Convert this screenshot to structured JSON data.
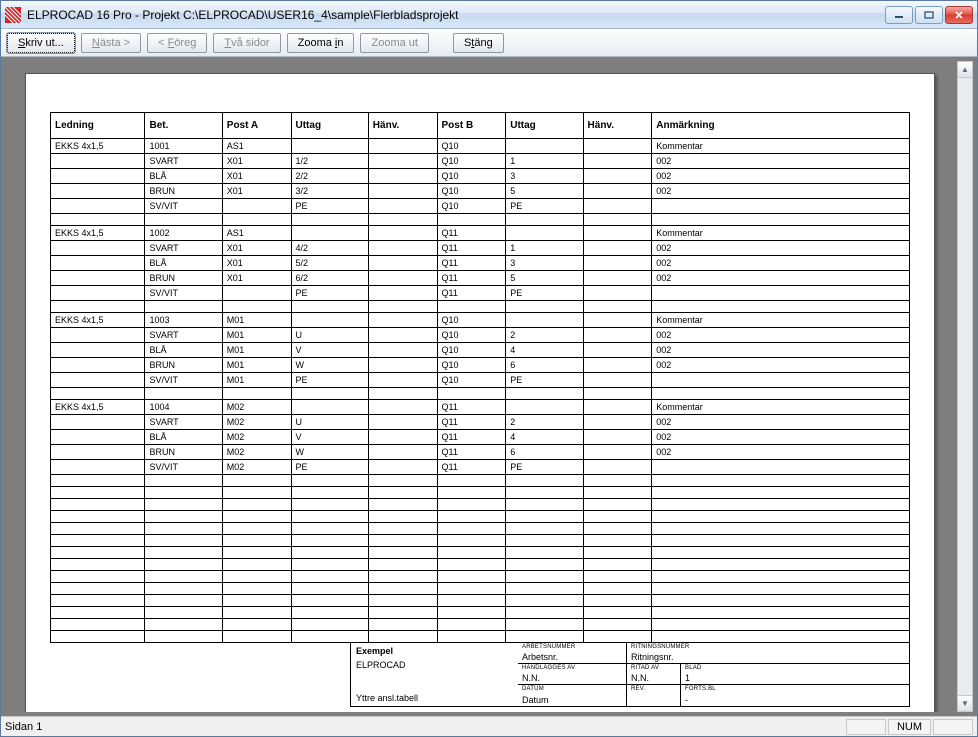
{
  "window": {
    "title": "ELPROCAD 16 Pro - Projekt C:\\ELPROCAD\\USER16_4\\sample\\Flerbladsprojekt"
  },
  "toolbar": {
    "print": "Skriv ut...",
    "next": "Nästa >",
    "prev": "< Föreg",
    "two_pages": "Två sidor",
    "zoom_in": "Zooma in",
    "zoom_out": "Zooma ut",
    "close": "Stäng"
  },
  "table": {
    "headers": {
      "ledning": "Ledning",
      "bet": "Bet.",
      "post_a": "Post A",
      "uttag_a": "Uttag",
      "hanv_a": "Hänv.",
      "post_b": "Post B",
      "uttag_b": "Uttag",
      "hanv_b": "Hänv.",
      "anm": "Anmärkning"
    },
    "groups": [
      {
        "ledning": "EKKS 4x1,5",
        "bet": "1001",
        "post_a": "AS1",
        "post_b": "Q10",
        "anm": "Kommentar",
        "rows": [
          {
            "bet": "SVART",
            "post_a": "X01",
            "uttag_a": "1/2",
            "post_b": "Q10",
            "uttag_b": "1",
            "anm": "002"
          },
          {
            "bet": "BLÅ",
            "post_a": "X01",
            "uttag_a": "2/2",
            "post_b": "Q10",
            "uttag_b": "3",
            "anm": "002"
          },
          {
            "bet": "BRUN",
            "post_a": "X01",
            "uttag_a": "3/2",
            "post_b": "Q10",
            "uttag_b": "5",
            "anm": "002"
          },
          {
            "bet": "SV/VIT",
            "post_a": "",
            "uttag_a": "PE",
            "post_b": "Q10",
            "uttag_b": "PE",
            "anm": ""
          }
        ]
      },
      {
        "ledning": "EKKS 4x1,5",
        "bet": "1002",
        "post_a": "AS1",
        "post_b": "Q11",
        "anm": "Kommentar",
        "rows": [
          {
            "bet": "SVART",
            "post_a": "X01",
            "uttag_a": "4/2",
            "post_b": "Q11",
            "uttag_b": "1",
            "anm": "002"
          },
          {
            "bet": "BLÅ",
            "post_a": "X01",
            "uttag_a": "5/2",
            "post_b": "Q11",
            "uttag_b": "3",
            "anm": "002"
          },
          {
            "bet": "BRUN",
            "post_a": "X01",
            "uttag_a": "6/2",
            "post_b": "Q11",
            "uttag_b": "5",
            "anm": "002"
          },
          {
            "bet": "SV/VIT",
            "post_a": "",
            "uttag_a": "PE",
            "post_b": "Q11",
            "uttag_b": "PE",
            "anm": ""
          }
        ]
      },
      {
        "ledning": "EKKS 4x1,5",
        "bet": "1003",
        "post_a": "M01",
        "post_b": "Q10",
        "anm": "Kommentar",
        "rows": [
          {
            "bet": "SVART",
            "post_a": "M01",
            "uttag_a": "U",
            "post_b": "Q10",
            "uttag_b": "2",
            "anm": "002"
          },
          {
            "bet": "BLÅ",
            "post_a": "M01",
            "uttag_a": "V",
            "post_b": "Q10",
            "uttag_b": "4",
            "anm": "002"
          },
          {
            "bet": "BRUN",
            "post_a": "M01",
            "uttag_a": "W",
            "post_b": "Q10",
            "uttag_b": "6",
            "anm": "002"
          },
          {
            "bet": "SV/VIT",
            "post_a": "M01",
            "uttag_a": "PE",
            "post_b": "Q10",
            "uttag_b": "PE",
            "anm": ""
          }
        ]
      },
      {
        "ledning": "EKKS 4x1,5",
        "bet": "1004",
        "post_a": "M02",
        "post_b": "Q11",
        "anm": "Kommentar",
        "rows": [
          {
            "bet": "SVART",
            "post_a": "M02",
            "uttag_a": "U",
            "post_b": "Q11",
            "uttag_b": "2",
            "anm": "002"
          },
          {
            "bet": "BLÅ",
            "post_a": "M02",
            "uttag_a": "V",
            "post_b": "Q11",
            "uttag_b": "4",
            "anm": "002"
          },
          {
            "bet": "BRUN",
            "post_a": "M02",
            "uttag_a": "W",
            "post_b": "Q11",
            "uttag_b": "6",
            "anm": "002"
          },
          {
            "bet": "SV/VIT",
            "post_a": "M02",
            "uttag_a": "PE",
            "post_b": "Q11",
            "uttag_b": "PE",
            "anm": ""
          }
        ]
      }
    ],
    "empty_rows": 14
  },
  "footer": {
    "exempel": "Exempel",
    "company": "ELPROCAD",
    "subtitle": "Yttre ansl.tabell",
    "arbetsnr_lbl": "ARBETSNUMMER",
    "arbetsnr": "Arbetsnr.",
    "ritningsnr_lbl": "RITNINGSNUMMER",
    "ritningsnr": "Ritningsnr.",
    "handl_lbl": "HANDLÄGGES AV",
    "handl": "N.N.",
    "ritad_lbl": "RITAD AV",
    "ritad": "N.N.",
    "blad_lbl": "BLAD",
    "blad": "1",
    "datum_lbl": "DATUM",
    "datum": "Datum",
    "rev_lbl": "REV.",
    "rev": "",
    "forts_lbl": "FORTS.BL",
    "forts": "-"
  },
  "status": {
    "page": "Sidan 1",
    "num": "NUM"
  }
}
